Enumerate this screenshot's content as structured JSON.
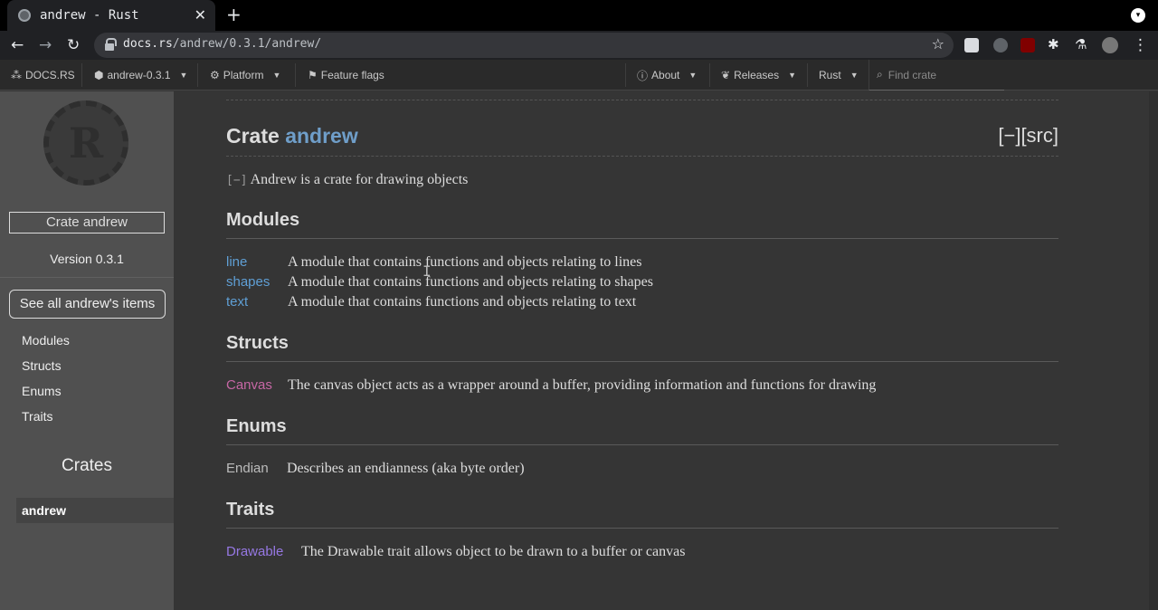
{
  "browser": {
    "tab_title": "andrew - Rust",
    "tab_close": "✕",
    "new_tab": "+",
    "url_host": "docs.rs",
    "url_path": "/andrew/0.3.1/andrew/"
  },
  "docsnav": {
    "logo": "DOCS.RS",
    "crate_version": "andrew-0.3.1",
    "platform": "Platform",
    "feature_flags": "Feature flags",
    "about": "About",
    "releases": "Releases",
    "rust": "Rust",
    "search_placeholder": "Find crate"
  },
  "sidebar": {
    "logo_letter": "R",
    "crate_label": "Crate andrew",
    "version": "Version 0.3.1",
    "see_all": "See all andrew's items",
    "links": [
      "Modules",
      "Structs",
      "Enums",
      "Traits"
    ],
    "crates_title": "Crates",
    "crates": [
      "andrew"
    ]
  },
  "main": {
    "title_prefix": "Crate ",
    "title_name": "andrew",
    "src": "[−][src]",
    "toggle": "[−]",
    "description": " Andrew is a crate for drawing objects",
    "sections": {
      "modules": "Modules",
      "structs": "Structs",
      "enums": "Enums",
      "traits": "Traits"
    },
    "modules": [
      {
        "name": "line",
        "desc": "A module that contains functions and objects relating to lines"
      },
      {
        "name": "shapes",
        "desc": "A module that contains functions and objects relating to shapes"
      },
      {
        "name": "text",
        "desc": "A module that contains functions and objects relating to text"
      }
    ],
    "structs": [
      {
        "name": "Canvas",
        "desc": "The canvas object acts as a wrapper around a buffer, providing information and functions for drawing"
      }
    ],
    "enums": [
      {
        "name": "Endian",
        "desc": "Describes an endianness (aka byte order)"
      }
    ],
    "traits": [
      {
        "name": "Drawable",
        "desc": "The Drawable trait allows object to be drawn to a buffer or canvas"
      }
    ]
  },
  "colors": {
    "module": "#5f9fd5",
    "struct": "#c667a5",
    "enum": "#bcbcbc",
    "trait": "#9678e3"
  }
}
